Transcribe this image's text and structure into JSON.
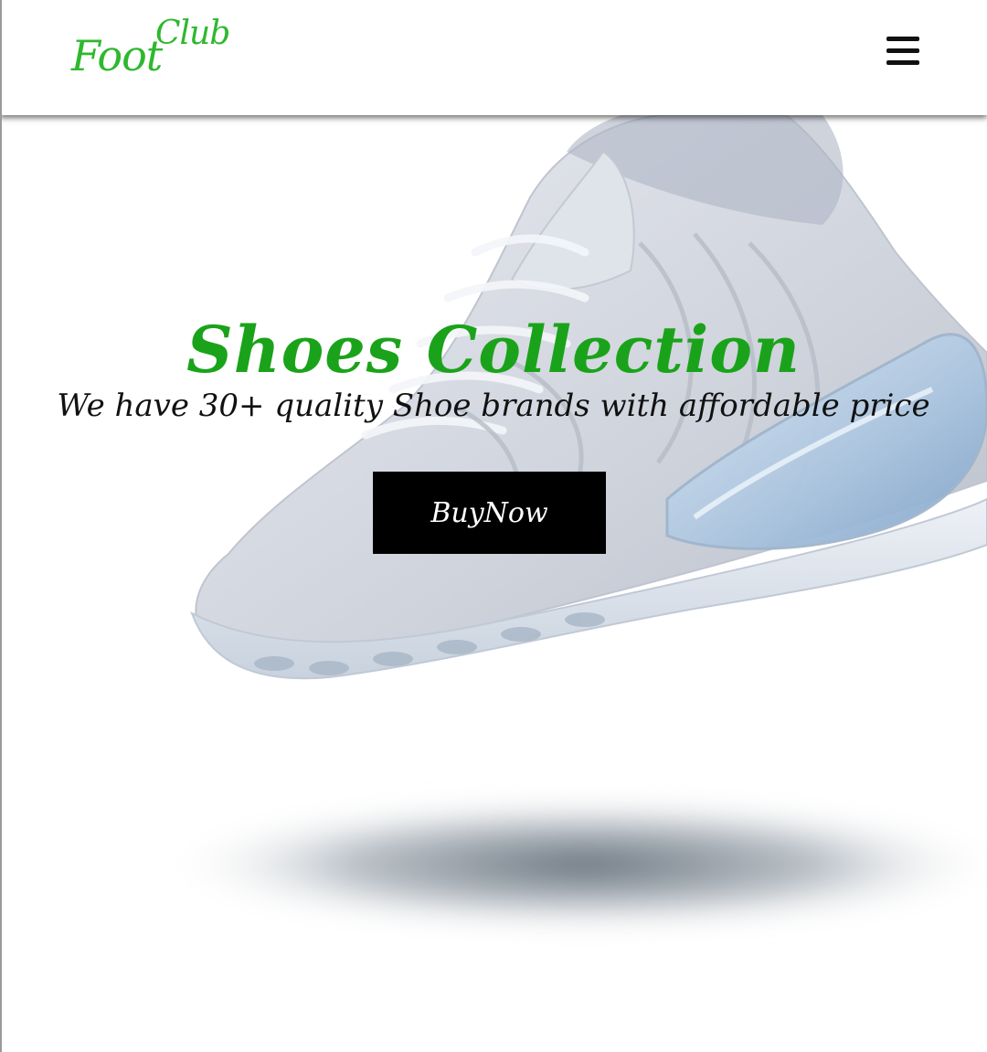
{
  "header": {
    "logo_part1": "Foot",
    "logo_part2": "Club",
    "menu_icon": "hamburger-menu-icon"
  },
  "hero": {
    "image": "white-sneaker-with-shadow",
    "title": "Shoes Collection",
    "subtitle": "We have 30+ quality Shoe brands with affordable price",
    "cta_label": "BuyNow"
  },
  "colors": {
    "brand_green": "#2eb82e",
    "title_green": "#1aa31a",
    "button_bg": "#000000",
    "button_text": "#ffffff"
  }
}
